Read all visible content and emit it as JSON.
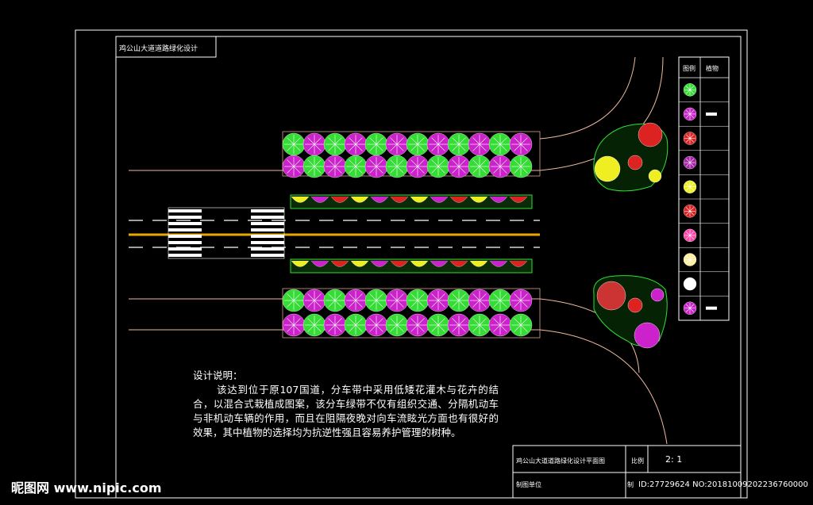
{
  "drawing": {
    "title_tag": "鸡公山大道道路绿化设计",
    "notes_heading": "设计说明：",
    "notes_body": "该达到位于原107国道，分车带中采用低矮花灌木与花卉的结合，以混合式栽植成图案，该分车绿带不仅有组织交通、分隔机动车与非机动车辆的作用，而且在阻隔夜晚对向车流眩光方面也有很好的效果，其中植物的选择均为抗逆性强且容易养护管理的树种。"
  },
  "title_block": {
    "drawing_name": "鸡公山大道道路绿化设计平面图",
    "ratio_label": "比例",
    "ratio_value": "2: 1",
    "unit_label": "制图单位",
    "draw_label": "制"
  },
  "legend": {
    "col_symbol": "图例",
    "col_name": "植物",
    "items": [
      {
        "name": "",
        "color": "#33dd33",
        "icon": "green-tree-icon"
      },
      {
        "name": "",
        "color": "#cc22cc",
        "icon": "magenta-tree-icon"
      },
      {
        "name": "",
        "color": "#dd2222",
        "icon": "red-shrub-icon"
      },
      {
        "name": "",
        "color": "#aa22aa",
        "icon": "purple-shrub-icon"
      },
      {
        "name": "",
        "color": "#eeee22",
        "icon": "yellow-flower-icon"
      },
      {
        "name": "",
        "color": "#dd2222",
        "icon": "red-flower-icon"
      },
      {
        "name": "",
        "color": "#ff44aa",
        "icon": "pink-flower-icon"
      },
      {
        "name": "",
        "color": "#ffee99",
        "icon": "cream-flower-icon"
      },
      {
        "name": "",
        "color": "#ffffff",
        "icon": "white-plant-icon"
      },
      {
        "name": "",
        "color": "#cc22cc",
        "icon": "magenta-tree-icon"
      }
    ]
  },
  "watermark": {
    "site": "昵图网 www.nipic.com",
    "id_text": "ID:27729624 NO:20181009202236760000"
  },
  "colors": {
    "green": "#33dd33",
    "magenta": "#cc22cc",
    "red": "#dd2222",
    "yellow": "#eeee22",
    "centerline": "#e8a800",
    "road_edge": "#f0b8a0"
  }
}
